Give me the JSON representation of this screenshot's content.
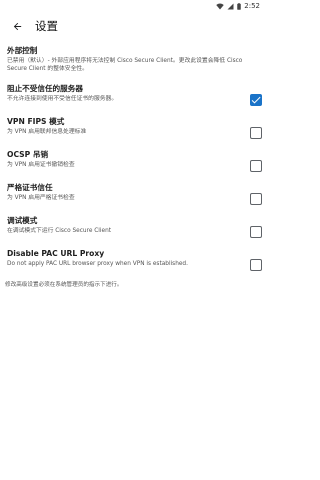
{
  "status_bar": {
    "time": "2:52"
  },
  "app_bar": {
    "title": "设置"
  },
  "header_section": {
    "title": "外部控制",
    "description": "已禁用（默认）- 外部应用程序将无法控制 Cisco Secure Client。更改此设置会降低 Cisco Secure Client 的整体安全性。"
  },
  "settings": [
    {
      "title": "阻止不受信任的服务器",
      "description": "不允许连接到使用不受信任证书的服务器。",
      "checked": true
    },
    {
      "title": "VPN FIPS 模式",
      "description": "为 VPN 启用联邦信息处理标准",
      "checked": false
    },
    {
      "title": "OCSP 吊销",
      "description": "为 VPN 启用证书撤销检查",
      "checked": false
    },
    {
      "title": "严格证书信任",
      "description": "为 VPN 启用严格证书检查",
      "checked": false
    },
    {
      "title": "调试模式",
      "description": "在调试模式下运行 Cisco Secure Client",
      "checked": false
    },
    {
      "title": "Disable PAC URL Proxy",
      "description": "Do not apply PAC URL browser proxy when VPN is established.",
      "checked": false
    }
  ],
  "footnote": "修改高级设置必须在系统管理员的指示下进行。",
  "icons": {
    "back": "arrow-left-icon",
    "wifi": "wifi-icon",
    "signal": "cell-signal-icon",
    "battery": "battery-icon"
  },
  "colors": {
    "accent": "#1a73c8"
  }
}
